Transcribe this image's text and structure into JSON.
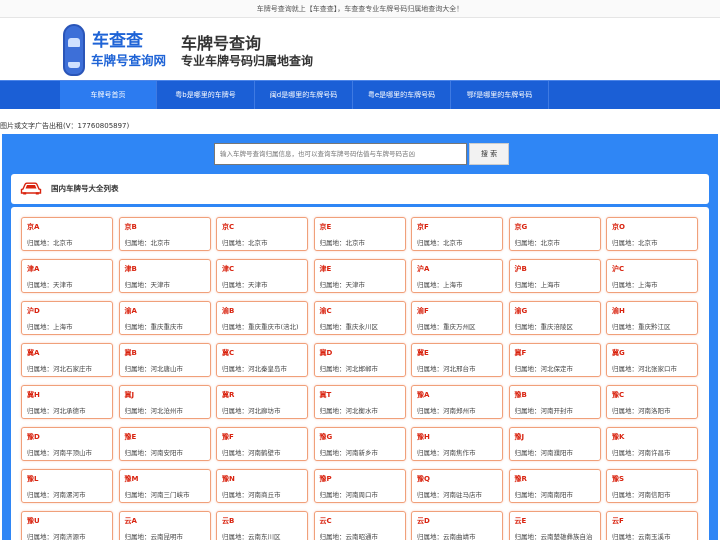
{
  "topbar": {
    "text": "车牌号查询就上【车查查】，车查查专业车牌号码归属地查询大全！"
  },
  "logo": {
    "main": "车查查",
    "sub": "车牌号查询网"
  },
  "header": {
    "title": "车牌号查询",
    "slogan": "专业车牌号码归属地查询"
  },
  "nav": {
    "items": [
      {
        "label": "车牌号首页",
        "active": true
      },
      {
        "label": "粤b是哪里的车牌号",
        "active": false
      },
      {
        "label": "闽d是哪里的车牌号码",
        "active": false
      },
      {
        "label": "粤e是哪里的车牌号码",
        "active": false
      },
      {
        "label": "鄂f是哪里的车牌号码",
        "active": false
      }
    ]
  },
  "ad": {
    "text": "图片或文字广告出租(V：17760805897)"
  },
  "search": {
    "placeholder": "输入车牌号查询归属信息，也可以查询车牌号码估值与车牌号码吉凶",
    "button_label": "搜 索"
  },
  "list": {
    "title": "国内车牌号大全列表",
    "area_prefix": "归属地：",
    "rows": [
      [
        {
          "code": "京A",
          "area": "北京市"
        },
        {
          "code": "京B",
          "area": "北京市"
        },
        {
          "code": "京C",
          "area": "北京市"
        },
        {
          "code": "京E",
          "area": "北京市"
        },
        {
          "code": "京F",
          "area": "北京市"
        },
        {
          "code": "京G",
          "area": "北京市"
        },
        {
          "code": "京O",
          "area": "北京市"
        }
      ],
      [
        {
          "code": "津A",
          "area": "天津市"
        },
        {
          "code": "津B",
          "area": "天津市"
        },
        {
          "code": "津C",
          "area": "天津市"
        },
        {
          "code": "津E",
          "area": "天津市"
        },
        {
          "code": "沪A",
          "area": "上海市"
        },
        {
          "code": "沪B",
          "area": "上海市"
        },
        {
          "code": "沪C",
          "area": "上海市"
        }
      ],
      [
        {
          "code": "沪D",
          "area": "上海市"
        },
        {
          "code": "渝A",
          "area": "重庆重庆市"
        },
        {
          "code": "渝B",
          "area": "重庆重庆市(涪北)"
        },
        {
          "code": "渝C",
          "area": "重庆永川区"
        },
        {
          "code": "渝F",
          "area": "重庆万州区"
        },
        {
          "code": "渝G",
          "area": "重庆涪陵区"
        },
        {
          "code": "渝H",
          "area": "重庆黔江区"
        }
      ],
      [
        {
          "code": "冀A",
          "area": "河北石家庄市"
        },
        {
          "code": "冀B",
          "area": "河北唐山市"
        },
        {
          "code": "冀C",
          "area": "河北秦皇岛市"
        },
        {
          "code": "冀D",
          "area": "河北邯郸市"
        },
        {
          "code": "冀E",
          "area": "河北邢台市"
        },
        {
          "code": "冀F",
          "area": "河北保定市"
        },
        {
          "code": "冀G",
          "area": "河北张家口市"
        }
      ],
      [
        {
          "code": "冀H",
          "area": "河北承德市"
        },
        {
          "code": "冀J",
          "area": "河北沧州市"
        },
        {
          "code": "冀R",
          "area": "河北廊坊市"
        },
        {
          "code": "冀T",
          "area": "河北衡水市"
        },
        {
          "code": "豫A",
          "area": "河南郑州市"
        },
        {
          "code": "豫B",
          "area": "河南开封市"
        },
        {
          "code": "豫C",
          "area": "河南洛阳市"
        }
      ],
      [
        {
          "code": "豫D",
          "area": "河南平顶山市"
        },
        {
          "code": "豫E",
          "area": "河南安阳市"
        },
        {
          "code": "豫F",
          "area": "河南鹤壁市"
        },
        {
          "code": "豫G",
          "area": "河南新乡市"
        },
        {
          "code": "豫H",
          "area": "河南焦作市"
        },
        {
          "code": "豫J",
          "area": "河南濮阳市"
        },
        {
          "code": "豫K",
          "area": "河南许昌市"
        }
      ],
      [
        {
          "code": "豫L",
          "area": "河南漯河市"
        },
        {
          "code": "豫M",
          "area": "河南三门峡市"
        },
        {
          "code": "豫N",
          "area": "河南商丘市"
        },
        {
          "code": "豫P",
          "area": "河南周口市"
        },
        {
          "code": "豫Q",
          "area": "河南驻马店市"
        },
        {
          "code": "豫R",
          "area": "河南南阳市"
        },
        {
          "code": "豫S",
          "area": "河南信阳市"
        }
      ],
      [
        {
          "code": "豫U",
          "area": "河南济源市"
        },
        {
          "code": "云A",
          "area": "云南昆明市"
        },
        {
          "code": "云B",
          "area": "云南东川区"
        },
        {
          "code": "云C",
          "area": "云南昭通市"
        },
        {
          "code": "云D",
          "area": "云南曲靖市"
        },
        {
          "code": "云E",
          "area": "云南楚雄彝族自治"
        },
        {
          "code": "云F",
          "area": "云南玉溪市"
        }
      ]
    ]
  }
}
